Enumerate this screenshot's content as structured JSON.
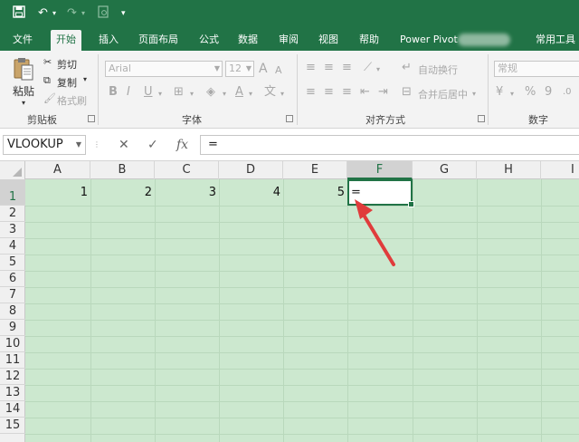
{
  "quick_access": {
    "save_icon": "save-icon",
    "undo_icon": "undo-icon",
    "redo_icon": "redo-icon",
    "preview_icon": "print-preview-icon",
    "customize_icon": "chevron-down-icon"
  },
  "tabs": [
    {
      "label": "文件"
    },
    {
      "label": "开始"
    },
    {
      "label": "插入"
    },
    {
      "label": "页面布局"
    },
    {
      "label": "公式"
    },
    {
      "label": "数据"
    },
    {
      "label": "审阅"
    },
    {
      "label": "视图"
    },
    {
      "label": "帮助"
    },
    {
      "label": "Power Pivot"
    },
    {
      "label": "常用工具"
    }
  ],
  "active_tab": "开始",
  "ribbon": {
    "clipboard": {
      "paste": "粘贴",
      "cut": "剪切",
      "copy": "复制",
      "format_painter": "格式刷",
      "group_label": "剪贴板"
    },
    "font": {
      "font_name": "Arial",
      "font_size": "12",
      "bold": "B",
      "italic": "I",
      "underline": "U",
      "grow": "A",
      "shrink": "A",
      "font_color": "A",
      "group_label": "字体"
    },
    "alignment": {
      "wrap_text": "自动换行",
      "merge_center": "合并后居中",
      "group_label": "对齐方式"
    },
    "number": {
      "format": "常规",
      "percent": "%",
      "comma": "9",
      "group_label": "数字"
    }
  },
  "formula_bar": {
    "name_box": "VLOOKUP",
    "cancel": "✕",
    "enter": "✓",
    "fx": "fx",
    "content": "="
  },
  "sheet": {
    "columns": [
      "A",
      "B",
      "C",
      "D",
      "E",
      "F",
      "G",
      "H",
      "I"
    ],
    "rows": [
      "1",
      "2",
      "3",
      "4",
      "5",
      "6",
      "7",
      "8",
      "9",
      "10",
      "11",
      "12",
      "13",
      "14",
      "15"
    ],
    "active_cell": "F1",
    "row1_values": [
      "1",
      "2",
      "3",
      "4",
      "5"
    ],
    "active_cell_value": "=",
    "accent_color": "#217346",
    "annotation_arrow_color": "#e03c3c"
  }
}
